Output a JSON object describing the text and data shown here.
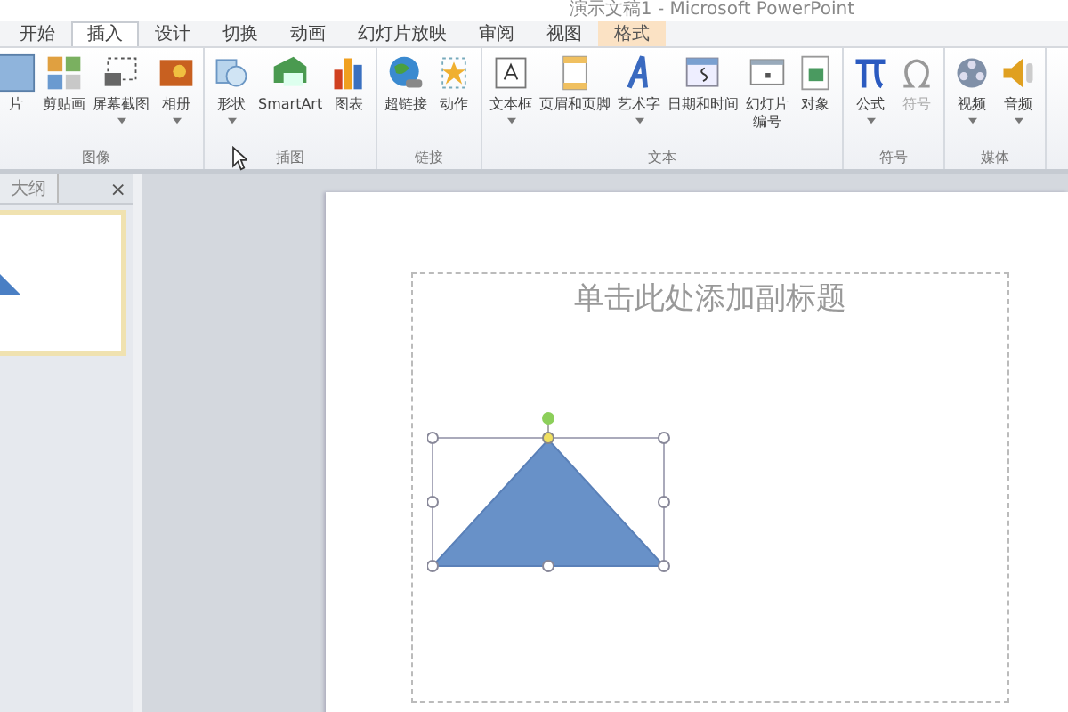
{
  "window": {
    "title": "演示文稿1 - Microsoft PowerPoint"
  },
  "tabs": [
    {
      "label": "开始",
      "selected": false,
      "kind": "normal"
    },
    {
      "label": "插入",
      "selected": true,
      "kind": "normal"
    },
    {
      "label": "设计",
      "selected": false,
      "kind": "normal"
    },
    {
      "label": "切换",
      "selected": false,
      "kind": "normal"
    },
    {
      "label": "动画",
      "selected": false,
      "kind": "normal"
    },
    {
      "label": "幻灯片放映",
      "selected": false,
      "kind": "normal"
    },
    {
      "label": "审阅",
      "selected": false,
      "kind": "normal"
    },
    {
      "label": "视图",
      "selected": false,
      "kind": "normal"
    },
    {
      "label": "格式",
      "selected": false,
      "kind": "contextual"
    }
  ],
  "ribbon": [
    {
      "label": "图像",
      "items": [
        {
          "label": "片",
          "kind": "picture",
          "dropdown": false,
          "disabled": false
        },
        {
          "label": "剪贴画",
          "kind": "clipart",
          "dropdown": false,
          "disabled": false
        },
        {
          "label": "屏幕截图",
          "kind": "screenshot",
          "dropdown": true,
          "disabled": false
        },
        {
          "label": "相册",
          "kind": "album",
          "dropdown": true,
          "disabled": false
        }
      ]
    },
    {
      "label": "插图",
      "items": [
        {
          "label": "形状",
          "kind": "shapes",
          "dropdown": true,
          "disabled": false
        },
        {
          "label": "SmartArt",
          "kind": "smartart",
          "dropdown": false,
          "disabled": false
        },
        {
          "label": "图表",
          "kind": "chart",
          "dropdown": false,
          "disabled": false
        }
      ]
    },
    {
      "label": "链接",
      "items": [
        {
          "label": "超链接",
          "kind": "globe",
          "dropdown": false,
          "disabled": false
        },
        {
          "label": "动作",
          "kind": "star",
          "dropdown": false,
          "disabled": false
        }
      ]
    },
    {
      "label": "文本",
      "items": [
        {
          "label": "文本框",
          "kind": "textbox",
          "dropdown": true,
          "disabled": false
        },
        {
          "label": "页眉和页脚",
          "kind": "page",
          "dropdown": false,
          "disabled": false
        },
        {
          "label": "艺术字",
          "kind": "wordart",
          "dropdown": true,
          "disabled": false
        },
        {
          "label": "日期和时间",
          "kind": "date",
          "dropdown": false,
          "disabled": false
        },
        {
          "label": "幻灯片",
          "label_line2": "编号",
          "kind": "slide",
          "dropdown": false,
          "disabled": false
        },
        {
          "label": "对象",
          "kind": "object",
          "dropdown": false,
          "disabled": false
        }
      ]
    },
    {
      "label": "符号",
      "items": [
        {
          "label": "公式",
          "kind": "pi",
          "dropdown": true,
          "disabled": false
        },
        {
          "label": "符号",
          "kind": "omega",
          "dropdown": false,
          "disabled": true
        }
      ]
    },
    {
      "label": "媒体",
      "items": [
        {
          "label": "视频",
          "kind": "film",
          "dropdown": true,
          "disabled": false
        },
        {
          "label": "音频",
          "kind": "speaker",
          "dropdown": true,
          "disabled": false
        }
      ]
    }
  ],
  "outline_pane": {
    "tab": "大纲",
    "close": "×"
  },
  "slide": {
    "subtitle_placeholder": "单击此处添加副标题"
  }
}
